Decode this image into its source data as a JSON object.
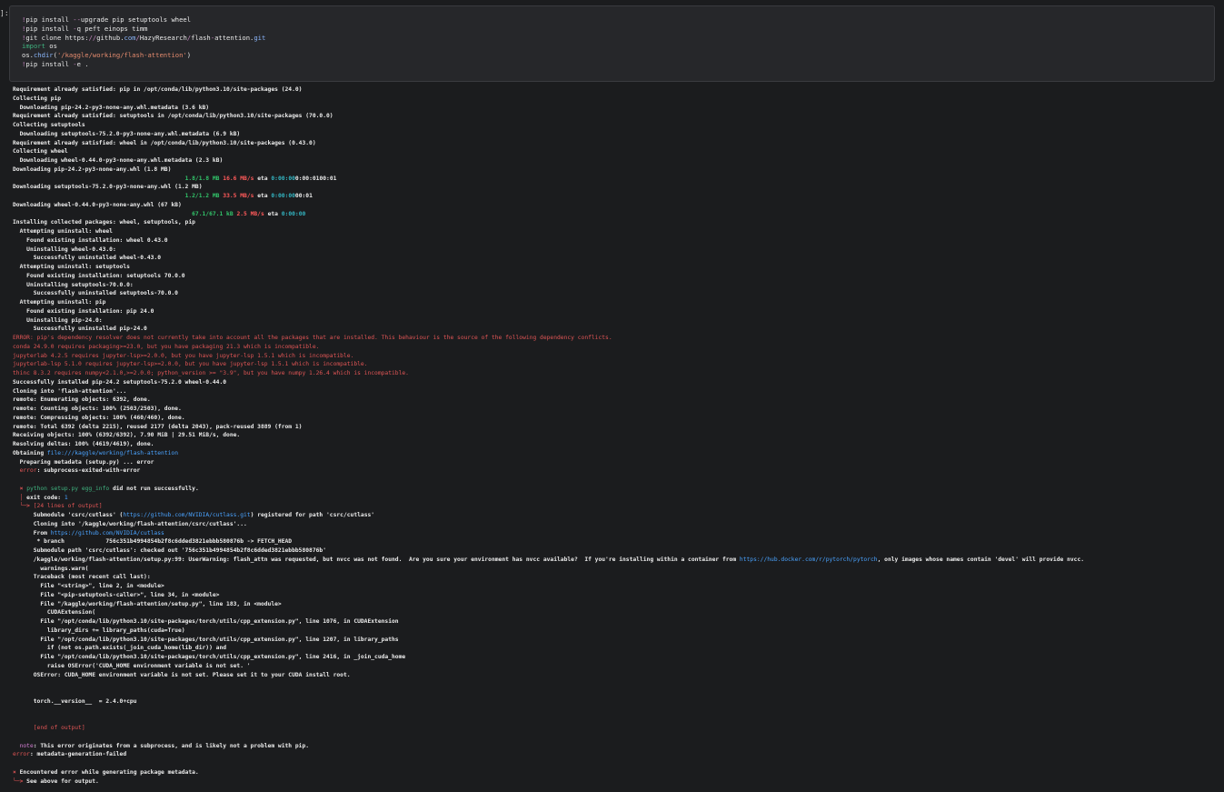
{
  "cell": {
    "prompt": "]:",
    "code_lines": [
      [
        {
          "t": "!",
          "c": "p"
        },
        {
          "t": "pip install ",
          "c": "w"
        },
        {
          "t": "--",
          "c": "p"
        },
        {
          "t": "upgrade pip setuptools wheel",
          "c": "w"
        }
      ],
      [
        {
          "t": "!",
          "c": "p"
        },
        {
          "t": "pip install ",
          "c": "w"
        },
        {
          "t": "-",
          "c": "p"
        },
        {
          "t": "q peft einops timm",
          "c": "w"
        }
      ],
      [
        {
          "t": "!",
          "c": "p"
        },
        {
          "t": "git clone https:",
          "c": "w"
        },
        {
          "t": "//",
          "c": "p"
        },
        {
          "t": "github.",
          "c": "w"
        },
        {
          "t": "com",
          "c": "k"
        },
        {
          "t": "/",
          "c": "p"
        },
        {
          "t": "HazyResearch",
          "c": "w"
        },
        {
          "t": "/",
          "c": "p"
        },
        {
          "t": "flash",
          "c": "w"
        },
        {
          "t": "-",
          "c": "p"
        },
        {
          "t": "attention.",
          "c": "w"
        },
        {
          "t": "git",
          "c": "k"
        }
      ],
      [
        {
          "t": "import",
          "c": "g"
        },
        {
          "t": " os",
          "c": "w"
        }
      ],
      [
        {
          "t": "os.",
          "c": "w"
        },
        {
          "t": "chdir",
          "c": "k"
        },
        {
          "t": "(",
          "c": "w"
        },
        {
          "t": "'/kaggle/working/flash-attention'",
          "c": "s"
        },
        {
          "t": ")",
          "c": "w"
        }
      ],
      [
        {
          "t": "!",
          "c": "p"
        },
        {
          "t": "pip install ",
          "c": "w"
        },
        {
          "t": "-",
          "c": "p"
        },
        {
          "t": "e .",
          "c": "w"
        }
      ]
    ]
  },
  "output_lines": [
    [
      {
        "t": "Requirement already satisfied: pip in /opt/conda/lib/python3.10/site-packages (24.0)"
      }
    ],
    [
      {
        "t": "Collecting pip"
      }
    ],
    [
      {
        "t": "  Downloading pip-24.2-py3-none-any.whl.metadata (3.6 kB)"
      }
    ],
    [
      {
        "t": "Requirement already satisfied: setuptools in /opt/conda/lib/python3.10/site-packages (70.0.0)"
      }
    ],
    [
      {
        "t": "Collecting setuptools"
      }
    ],
    [
      {
        "t": "  Downloading setuptools-75.2.0-py3-none-any.whl.metadata (6.9 kB)"
      }
    ],
    [
      {
        "t": "Requirement already satisfied: wheel in /opt/conda/lib/python3.10/site-packages (0.43.0)"
      }
    ],
    [
      {
        "t": "Collecting wheel"
      }
    ],
    [
      {
        "t": "  Downloading wheel-0.44.0-py3-none-any.whl.metadata (2.3 kB)"
      }
    ],
    [
      {
        "t": "Downloading pip-24.2-py3-none-any.whl (1.8 MB)"
      }
    ],
    [
      {
        "t": "                                                  "
      },
      {
        "t": "1.8/1.8 MB",
        "c": "gt"
      },
      {
        "t": " "
      },
      {
        "t": "16.6 MB/s",
        "c": "rt"
      },
      {
        "t": " eta "
      },
      {
        "t": "0:00:00",
        "c": "ct"
      },
      {
        "t": "0:00:01",
        "c": "w"
      },
      {
        "t": "00:01",
        "c": "w"
      }
    ],
    [
      {
        "t": "Downloading setuptools-75.2.0-py3-none-any.whl (1.2 MB)"
      }
    ],
    [
      {
        "t": "                                                  "
      },
      {
        "t": "1.2/1.2 MB",
        "c": "gt"
      },
      {
        "t": " "
      },
      {
        "t": "33.5 MB/s",
        "c": "rt"
      },
      {
        "t": " eta "
      },
      {
        "t": "0:00:00",
        "c": "ct"
      },
      {
        "t": "00:01"
      }
    ],
    [
      {
        "t": "Downloading wheel-0.44.0-py3-none-any.whl (67 kB)"
      }
    ],
    [
      {
        "t": "                                                    "
      },
      {
        "t": "67.1/67.1 kB",
        "c": "gt"
      },
      {
        "t": " "
      },
      {
        "t": "2.5 MB/s",
        "c": "rt"
      },
      {
        "t": " eta "
      },
      {
        "t": "0:00:00",
        "c": "ct"
      }
    ],
    [
      {
        "t": "Installing collected packages: wheel, setuptools, pip"
      }
    ],
    [
      {
        "t": "  Attempting uninstall: wheel"
      }
    ],
    [
      {
        "t": "    Found existing installation: wheel 0.43.0"
      }
    ],
    [
      {
        "t": "    Uninstalling wheel-0.43.0:"
      }
    ],
    [
      {
        "t": "      Successfully uninstalled wheel-0.43.0"
      }
    ],
    [
      {
        "t": "  Attempting uninstall: setuptools"
      }
    ],
    [
      {
        "t": "    Found existing installation: setuptools 70.0.0"
      }
    ],
    [
      {
        "t": "    Uninstalling setuptools-70.0.0:"
      }
    ],
    [
      {
        "t": "      Successfully uninstalled setuptools-70.0.0"
      }
    ],
    [
      {
        "t": "  Attempting uninstall: pip"
      }
    ],
    [
      {
        "t": "    Found existing installation: pip 24.0"
      }
    ],
    [
      {
        "t": "    Uninstalling pip-24.0:"
      }
    ],
    [
      {
        "t": "      Successfully uninstalled pip-24.0"
      }
    ],
    [
      {
        "t": "ERROR: pip's dependency resolver does not currently take into account all the packages that are installed. This behaviour is the source of the following dependency conflicts.",
        "c": "r nb"
      }
    ],
    [
      {
        "t": "conda 24.9.0 requires packaging>=23.0, but you have packaging 21.3 which is incompatible.",
        "c": "r nb"
      }
    ],
    [
      {
        "t": "jupyterlab 4.2.5 requires jupyter-lsp>=2.0.0, but you have jupyter-lsp 1.5.1 which is incompatible.",
        "c": "r nb"
      }
    ],
    [
      {
        "t": "jupyterlab-lsp 5.1.0 requires jupyter-lsp>=2.0.0, but you have jupyter-lsp 1.5.1 which is incompatible.",
        "c": "r nb"
      }
    ],
    [
      {
        "t": "thinc 8.3.2 requires numpy<2.1.0,>=2.0.0; python_version >= \"3.9\", but you have numpy 1.26.4 which is incompatible.",
        "c": "r nb"
      }
    ],
    [
      {
        "t": "Successfully installed pip-24.2 setuptools-75.2.0 wheel-0.44.0"
      }
    ],
    [
      {
        "t": "Cloning into 'flash-attention'..."
      }
    ],
    [
      {
        "t": "remote: Enumerating objects: 6392, done."
      }
    ],
    [
      {
        "t": "remote: Counting objects: 100% (2503/2503), done."
      }
    ],
    [
      {
        "t": "remote: Compressing objects: 100% (460/460), done."
      }
    ],
    [
      {
        "t": "remote: Total 6392 (delta 2215), reused 2177 (delta 2043), pack-reused 3889 (from 1)"
      }
    ],
    [
      {
        "t": "Receiving objects: 100% (6392/6392), 7.90 MiB | 29.51 MiB/s, done."
      }
    ],
    [
      {
        "t": "Resolving deltas: 100% (4619/4619), done."
      }
    ],
    [
      {
        "t": "Obtaining "
      },
      {
        "t": "file:///kaggle/working/flash-attention",
        "c": "b nb"
      }
    ],
    [
      {
        "t": "  Preparing metadata (setup.py) ... error"
      }
    ],
    [
      {
        "t": "  "
      },
      {
        "t": "error",
        "c": "r nb"
      },
      {
        "t": ": subprocess-exited-with-error"
      }
    ],
    [
      {
        "t": ""
      }
    ],
    [
      {
        "t": "  "
      },
      {
        "t": "×",
        "c": "r"
      },
      {
        "t": " "
      },
      {
        "t": "python setup.py egg_info",
        "c": "g nb"
      },
      {
        "t": " did not run successfully."
      }
    ],
    [
      {
        "t": "  "
      },
      {
        "t": "│",
        "c": "r"
      },
      {
        "t": " exit code: "
      },
      {
        "t": "1",
        "c": "b nb"
      }
    ],
    [
      {
        "t": "  "
      },
      {
        "t": "╰─>",
        "c": "r"
      },
      {
        "t": " "
      },
      {
        "t": "[24 lines of output]",
        "c": "r nb"
      }
    ],
    [
      {
        "t": "      Submodule 'csrc/cutlass' ("
      },
      {
        "t": "https://github.com/NVIDIA/cutlass.git",
        "c": "b nb"
      },
      {
        "t": ") registered for path 'csrc/cutlass'"
      }
    ],
    [
      {
        "t": "      Cloning into '/kaggle/working/flash-attention/csrc/cutlass'..."
      }
    ],
    [
      {
        "t": "      From "
      },
      {
        "t": "https://github.com/NVIDIA/cutlass",
        "c": "b nb"
      }
    ],
    [
      {
        "t": "       * branch            756c351b4994854b2f8c6dded3821ebbb580876b -> FETCH_HEAD"
      }
    ],
    [
      {
        "t": "      Submodule path 'csrc/cutlass': checked out '756c351b4994854b2f8c6dded3821ebbb580876b'"
      }
    ],
    [
      {
        "t": "      /kaggle/working/flash-attention/setup.py:99: UserWarning: flash_attn was requested, but nvcc was not found.  Are you sure your environment has nvcc available?  If you're installing within a container from "
      },
      {
        "t": "https://hub.docker.com/r/pytorch/pytorch",
        "c": "b nb"
      },
      {
        "t": ", only images whose names contain 'devel' will provide nvcc."
      }
    ],
    [
      {
        "t": "        warnings.warn("
      }
    ],
    [
      {
        "t": "      Traceback (most recent call last):"
      }
    ],
    [
      {
        "t": "        File \"<string>\", line 2, in <module>"
      }
    ],
    [
      {
        "t": "        File \"<pip-setuptools-caller>\", line 34, in <module>"
      }
    ],
    [
      {
        "t": "        File \"/kaggle/working/flash-attention/setup.py\", line 183, in <module>"
      }
    ],
    [
      {
        "t": "          CUDAExtension("
      }
    ],
    [
      {
        "t": "        File \"/opt/conda/lib/python3.10/site-packages/torch/utils/cpp_extension.py\", line 1076, in CUDAExtension"
      }
    ],
    [
      {
        "t": "          library_dirs += library_paths(cuda=True)"
      }
    ],
    [
      {
        "t": "        File \"/opt/conda/lib/python3.10/site-packages/torch/utils/cpp_extension.py\", line 1207, in library_paths"
      }
    ],
    [
      {
        "t": "          if (not os.path.exists(_join_cuda_home(lib_dir)) and"
      }
    ],
    [
      {
        "t": "        File \"/opt/conda/lib/python3.10/site-packages/torch/utils/cpp_extension.py\", line 2416, in _join_cuda_home"
      }
    ],
    [
      {
        "t": "          raise OSError('CUDA_HOME environment variable is not set. '"
      }
    ],
    [
      {
        "t": "      OSError: CUDA_HOME environment variable is not set. Please set it to your CUDA install root."
      }
    ],
    [
      {
        "t": ""
      }
    ],
    [
      {
        "t": ""
      }
    ],
    [
      {
        "t": "      torch.__version__  = 2.4.0+cpu"
      }
    ],
    [
      {
        "t": ""
      }
    ],
    [
      {
        "t": ""
      }
    ],
    [
      {
        "t": "      "
      },
      {
        "t": "[end of output]",
        "c": "r nb"
      }
    ],
    [
      {
        "t": ""
      }
    ],
    [
      {
        "t": "  "
      },
      {
        "t": "note",
        "c": "m nb"
      },
      {
        "t": ": This error originates from a subprocess, and is likely not a problem with pip."
      }
    ],
    [
      {
        "t": ""
      },
      {
        "t": "error",
        "c": "r nb"
      },
      {
        "t": ": metadata-generation-failed"
      }
    ],
    [
      {
        "t": ""
      }
    ],
    [
      {
        "t": ""
      },
      {
        "t": "×",
        "c": "r"
      },
      {
        "t": " Encountered error while generating package metadata."
      }
    ],
    [
      {
        "t": ""
      },
      {
        "t": "╰─>",
        "c": "r"
      },
      {
        "t": " See above for output."
      }
    ]
  ]
}
